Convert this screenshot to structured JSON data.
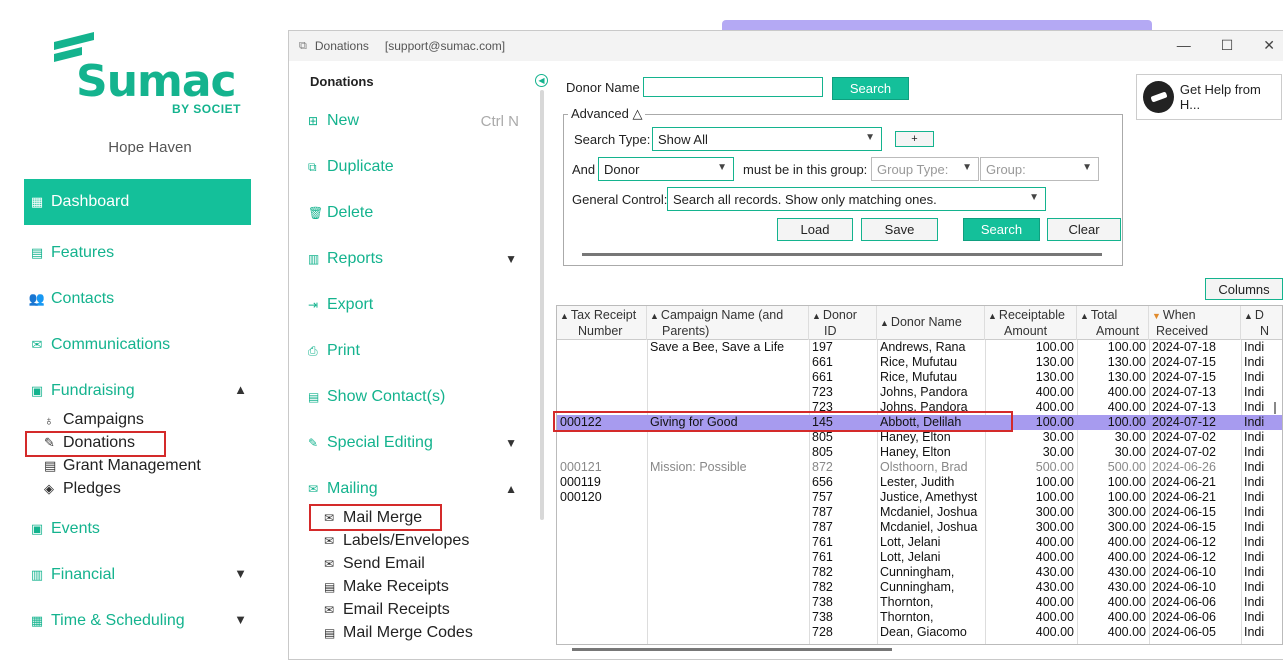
{
  "brand": {
    "name": "Sumac",
    "sub": "BY SOCIET",
    "org": "Hope Haven",
    "accent": "#14b38e"
  },
  "nav": {
    "dashboard": "Dashboard",
    "features": "Features",
    "contacts": "Contacts",
    "communications": "Communications",
    "fundraising": "Fundraising",
    "campaigns": "Campaigns",
    "donations": "Donations",
    "grant_management": "Grant Management",
    "pledges": "Pledges",
    "events": "Events",
    "financial": "Financial",
    "time_scheduling": "Time & Scheduling"
  },
  "window": {
    "title": "Donations",
    "account": "[support@sumac.com]"
  },
  "dmenu": {
    "title": "Donations",
    "new": "New",
    "new_shortcut": "Ctrl N",
    "duplicate": "Duplicate",
    "delete": "Delete",
    "reports": "Reports",
    "export": "Export",
    "print": "Print",
    "show_contacts": "Show Contact(s)",
    "special_editing": "Special Editing",
    "mailing": "Mailing",
    "mail_merge": "Mail Merge",
    "labels_envelopes": "Labels/Envelopes",
    "send_email": "Send Email",
    "make_receipts": "Make Receipts",
    "email_receipts": "Email Receipts",
    "mail_merge_codes": "Mail Merge Codes"
  },
  "search": {
    "donor_name_label": "Donor Name",
    "donor_name_value": "",
    "search_btn": "Search",
    "advanced_label": "Advanced",
    "search_type_label": "Search Type:",
    "search_type_value": "Show All",
    "plus_btn": "+",
    "and_label": "And",
    "and_value": "Donor",
    "group_label": "must be in this group:",
    "group_type_placeholder": "Group Type:",
    "group_placeholder": "Group:",
    "general_control_label": "General Control:",
    "general_control_value": "Search all records. Show only matching ones.",
    "load_btn": "Load",
    "save_btn": "Save",
    "search2_btn": "Search",
    "clear_btn": "Clear"
  },
  "help": {
    "label": "Get Help from H..."
  },
  "columns_btn": "Columns",
  "table": {
    "headers": {
      "tax": [
        "Tax Receipt",
        "Number"
      ],
      "campaign": [
        "Campaign Name (and",
        "Parents)"
      ],
      "donor_id": [
        "Donor",
        "ID"
      ],
      "donor_name": [
        "Donor Name"
      ],
      "receiptable": [
        "Receiptable",
        "Amount"
      ],
      "total": [
        "Total",
        "Amount"
      ],
      "when": [
        "When",
        "Received"
      ],
      "extra": [
        "D",
        "N"
      ]
    },
    "rows": [
      [
        "",
        "Save a Bee, Save a Life",
        "197",
        "Andrews, Rana",
        "100.00",
        "100.00",
        "2024-07-18",
        "Indi"
      ],
      [
        "",
        "",
        "661",
        "Rice, Mufutau",
        "130.00",
        "130.00",
        "2024-07-15",
        "Indi"
      ],
      [
        "",
        "",
        "661",
        "Rice, Mufutau",
        "130.00",
        "130.00",
        "2024-07-15",
        "Indi"
      ],
      [
        "",
        "",
        "723",
        "Johns, Pandora",
        "400.00",
        "400.00",
        "2024-07-13",
        "Indi"
      ],
      [
        "",
        "",
        "723",
        "Johns, Pandora",
        "400.00",
        "400.00",
        "2024-07-13",
        "Indi"
      ],
      [
        "000122",
        "Giving for Good",
        "145",
        "Abbott, Delilah",
        "100.00",
        "100.00",
        "2024-07-12",
        "Indi"
      ],
      [
        "",
        "",
        "805",
        "Haney, Elton",
        "30.00",
        "30.00",
        "2024-07-02",
        "Indi"
      ],
      [
        "",
        "",
        "805",
        "Haney, Elton",
        "30.00",
        "30.00",
        "2024-07-02",
        "Indi"
      ],
      [
        "000121",
        "Mission: Possible",
        "872",
        "Olsthoorn, Brad",
        "500.00",
        "500.00",
        "2024-06-26",
        "Indi"
      ],
      [
        "000119",
        "",
        "656",
        "Lester, Judith",
        "100.00",
        "100.00",
        "2024-06-21",
        "Indi"
      ],
      [
        "000120",
        "",
        "757",
        "Justice, Amethyst",
        "100.00",
        "100.00",
        "2024-06-21",
        "Indi"
      ],
      [
        "",
        "",
        "787",
        "Mcdaniel, Joshua",
        "300.00",
        "300.00",
        "2024-06-15",
        "Indi"
      ],
      [
        "",
        "",
        "787",
        "Mcdaniel, Joshua",
        "300.00",
        "300.00",
        "2024-06-15",
        "Indi"
      ],
      [
        "",
        "",
        "761",
        "Lott, Jelani",
        "400.00",
        "400.00",
        "2024-06-12",
        "Indi"
      ],
      [
        "",
        "",
        "761",
        "Lott, Jelani",
        "400.00",
        "400.00",
        "2024-06-12",
        "Indi"
      ],
      [
        "",
        "",
        "782",
        "Cunningham,",
        "430.00",
        "430.00",
        "2024-06-10",
        "Indi"
      ],
      [
        "",
        "",
        "782",
        "Cunningham,",
        "430.00",
        "430.00",
        "2024-06-10",
        "Indi"
      ],
      [
        "",
        "",
        "738",
        "Thornton,",
        "400.00",
        "400.00",
        "2024-06-06",
        "Indi"
      ],
      [
        "",
        "",
        "738",
        "Thornton,",
        "400.00",
        "400.00",
        "2024-06-06",
        "Indi"
      ],
      [
        "",
        "",
        "728",
        "Dean, Giacomo",
        "400.00",
        "400.00",
        "2024-06-05",
        "Indi"
      ]
    ],
    "selected_row": 5,
    "grey_row": 8
  }
}
